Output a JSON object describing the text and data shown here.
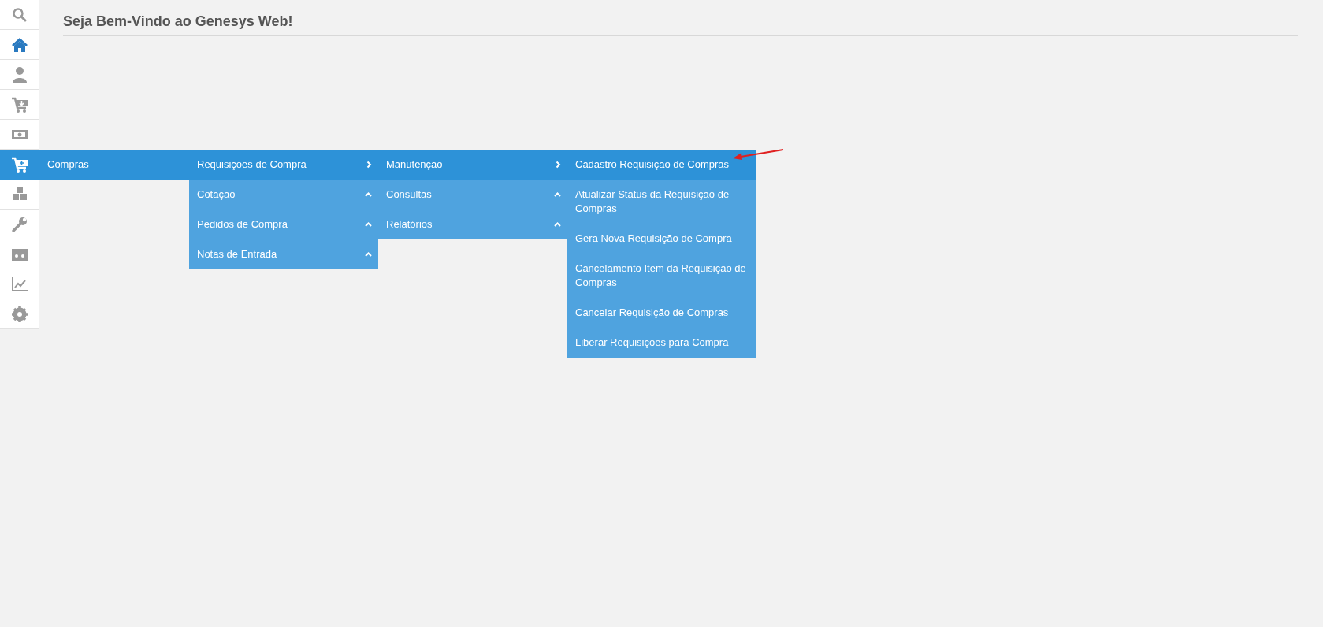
{
  "header": {
    "title": "Seja Bem-Vindo ao Genesys Web!"
  },
  "sidebar": {
    "items": [
      {
        "selected": false,
        "current": false
      },
      {
        "selected": false,
        "current": true
      },
      {
        "selected": false,
        "current": false
      },
      {
        "selected": false,
        "current": false
      },
      {
        "selected": false,
        "current": false
      },
      {
        "selected": true,
        "current": false
      },
      {
        "selected": false,
        "current": false
      },
      {
        "selected": false,
        "current": false
      },
      {
        "selected": false,
        "current": false
      },
      {
        "selected": false,
        "current": false
      },
      {
        "selected": false,
        "current": false
      }
    ]
  },
  "menu": {
    "label": "Compras",
    "columns": [
      [
        {
          "label": "Requisições de Compra",
          "kind": "submenu",
          "selected": true
        },
        {
          "label": "Cotação",
          "kind": "submenu",
          "selected": false
        },
        {
          "label": "Pedidos de Compra",
          "kind": "submenu",
          "selected": false
        },
        {
          "label": "Notas de Entrada",
          "kind": "submenu",
          "selected": false
        }
      ],
      [
        {
          "label": "Manutenção",
          "kind": "submenu",
          "selected": true
        },
        {
          "label": "Consultas",
          "kind": "submenu",
          "selected": false
        },
        {
          "label": "Relatórios",
          "kind": "submenu",
          "selected": false
        }
      ],
      [
        {
          "label": "Cadastro Requisição de Compras",
          "kind": "action",
          "selected": true
        },
        {
          "label": "Atualizar Status da Requisição de Compras",
          "kind": "action",
          "selected": false
        },
        {
          "label": "Gera Nova Requisição de Compra",
          "kind": "action",
          "selected": false
        },
        {
          "label": "Cancelamento Item da Requisição de Compras",
          "kind": "action",
          "selected": false
        },
        {
          "label": "Cancelar Requisição de Compras",
          "kind": "action",
          "selected": false
        },
        {
          "label": "Liberar Requisições para Compra",
          "kind": "action",
          "selected": false
        }
      ]
    ]
  }
}
